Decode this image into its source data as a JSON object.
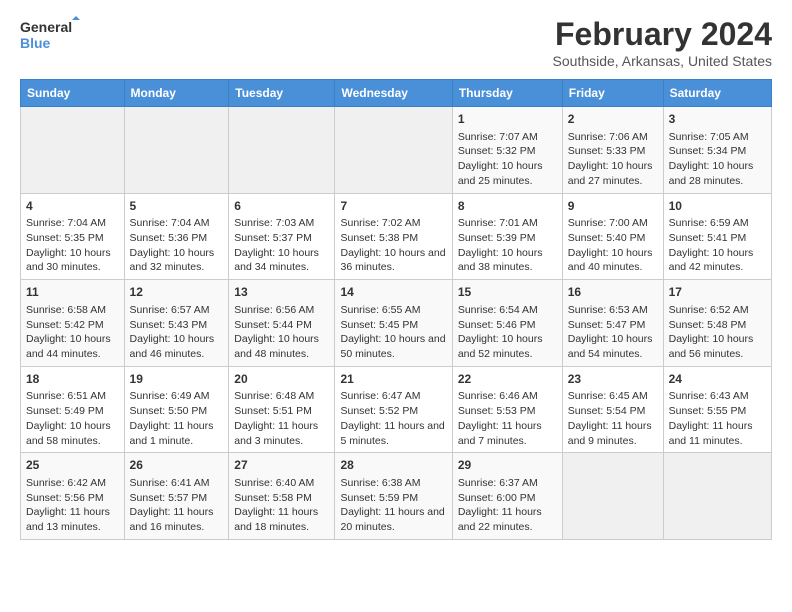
{
  "logo": {
    "line1": "General",
    "line2": "Blue"
  },
  "title": "February 2024",
  "subtitle": "Southside, Arkansas, United States",
  "days_header": [
    "Sunday",
    "Monday",
    "Tuesday",
    "Wednesday",
    "Thursday",
    "Friday",
    "Saturday"
  ],
  "weeks": [
    [
      {
        "day": "",
        "content": ""
      },
      {
        "day": "",
        "content": ""
      },
      {
        "day": "",
        "content": ""
      },
      {
        "day": "",
        "content": ""
      },
      {
        "day": "1",
        "content": "Sunrise: 7:07 AM\nSunset: 5:32 PM\nDaylight: 10 hours and 25 minutes."
      },
      {
        "day": "2",
        "content": "Sunrise: 7:06 AM\nSunset: 5:33 PM\nDaylight: 10 hours and 27 minutes."
      },
      {
        "day": "3",
        "content": "Sunrise: 7:05 AM\nSunset: 5:34 PM\nDaylight: 10 hours and 28 minutes."
      }
    ],
    [
      {
        "day": "4",
        "content": "Sunrise: 7:04 AM\nSunset: 5:35 PM\nDaylight: 10 hours and 30 minutes."
      },
      {
        "day": "5",
        "content": "Sunrise: 7:04 AM\nSunset: 5:36 PM\nDaylight: 10 hours and 32 minutes."
      },
      {
        "day": "6",
        "content": "Sunrise: 7:03 AM\nSunset: 5:37 PM\nDaylight: 10 hours and 34 minutes."
      },
      {
        "day": "7",
        "content": "Sunrise: 7:02 AM\nSunset: 5:38 PM\nDaylight: 10 hours and 36 minutes."
      },
      {
        "day": "8",
        "content": "Sunrise: 7:01 AM\nSunset: 5:39 PM\nDaylight: 10 hours and 38 minutes."
      },
      {
        "day": "9",
        "content": "Sunrise: 7:00 AM\nSunset: 5:40 PM\nDaylight: 10 hours and 40 minutes."
      },
      {
        "day": "10",
        "content": "Sunrise: 6:59 AM\nSunset: 5:41 PM\nDaylight: 10 hours and 42 minutes."
      }
    ],
    [
      {
        "day": "11",
        "content": "Sunrise: 6:58 AM\nSunset: 5:42 PM\nDaylight: 10 hours and 44 minutes."
      },
      {
        "day": "12",
        "content": "Sunrise: 6:57 AM\nSunset: 5:43 PM\nDaylight: 10 hours and 46 minutes."
      },
      {
        "day": "13",
        "content": "Sunrise: 6:56 AM\nSunset: 5:44 PM\nDaylight: 10 hours and 48 minutes."
      },
      {
        "day": "14",
        "content": "Sunrise: 6:55 AM\nSunset: 5:45 PM\nDaylight: 10 hours and 50 minutes."
      },
      {
        "day": "15",
        "content": "Sunrise: 6:54 AM\nSunset: 5:46 PM\nDaylight: 10 hours and 52 minutes."
      },
      {
        "day": "16",
        "content": "Sunrise: 6:53 AM\nSunset: 5:47 PM\nDaylight: 10 hours and 54 minutes."
      },
      {
        "day": "17",
        "content": "Sunrise: 6:52 AM\nSunset: 5:48 PM\nDaylight: 10 hours and 56 minutes."
      }
    ],
    [
      {
        "day": "18",
        "content": "Sunrise: 6:51 AM\nSunset: 5:49 PM\nDaylight: 10 hours and 58 minutes."
      },
      {
        "day": "19",
        "content": "Sunrise: 6:49 AM\nSunset: 5:50 PM\nDaylight: 11 hours and 1 minute."
      },
      {
        "day": "20",
        "content": "Sunrise: 6:48 AM\nSunset: 5:51 PM\nDaylight: 11 hours and 3 minutes."
      },
      {
        "day": "21",
        "content": "Sunrise: 6:47 AM\nSunset: 5:52 PM\nDaylight: 11 hours and 5 minutes."
      },
      {
        "day": "22",
        "content": "Sunrise: 6:46 AM\nSunset: 5:53 PM\nDaylight: 11 hours and 7 minutes."
      },
      {
        "day": "23",
        "content": "Sunrise: 6:45 AM\nSunset: 5:54 PM\nDaylight: 11 hours and 9 minutes."
      },
      {
        "day": "24",
        "content": "Sunrise: 6:43 AM\nSunset: 5:55 PM\nDaylight: 11 hours and 11 minutes."
      }
    ],
    [
      {
        "day": "25",
        "content": "Sunrise: 6:42 AM\nSunset: 5:56 PM\nDaylight: 11 hours and 13 minutes."
      },
      {
        "day": "26",
        "content": "Sunrise: 6:41 AM\nSunset: 5:57 PM\nDaylight: 11 hours and 16 minutes."
      },
      {
        "day": "27",
        "content": "Sunrise: 6:40 AM\nSunset: 5:58 PM\nDaylight: 11 hours and 18 minutes."
      },
      {
        "day": "28",
        "content": "Sunrise: 6:38 AM\nSunset: 5:59 PM\nDaylight: 11 hours and 20 minutes."
      },
      {
        "day": "29",
        "content": "Sunrise: 6:37 AM\nSunset: 6:00 PM\nDaylight: 11 hours and 22 minutes."
      },
      {
        "day": "",
        "content": ""
      },
      {
        "day": "",
        "content": ""
      }
    ]
  ]
}
